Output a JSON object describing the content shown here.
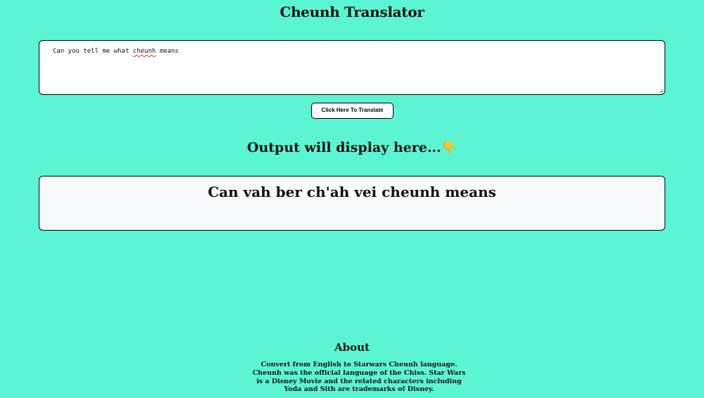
{
  "header": {
    "title": "Cheunh Translator"
  },
  "input": {
    "value_before": "Can you tell me what ",
    "value_misspelled": "cheunh",
    "value_after": " means"
  },
  "translate_button": {
    "label": "Click Here To Translate"
  },
  "output": {
    "heading": "Output will display here...",
    "heading_emoji": "👇",
    "text": "Can vah ber ch'ah vei cheunh means"
  },
  "about": {
    "title": "About",
    "line1": "Convert from English to Starwars Cheunh language.",
    "line2": "Cheunh was the official language of the Chiss. Star Wars is a Disney Movie and the related characters including Yoda and Sith are trademarks of Disney."
  },
  "icons": {
    "heading_emoji": "backhand-index-pointing-down",
    "resize_handle": "resize-grip-icon"
  },
  "colors": {
    "background": "#5cf5d3",
    "output_box": "#f8f9fb",
    "spellcheck_underline": "#d03a3a"
  }
}
